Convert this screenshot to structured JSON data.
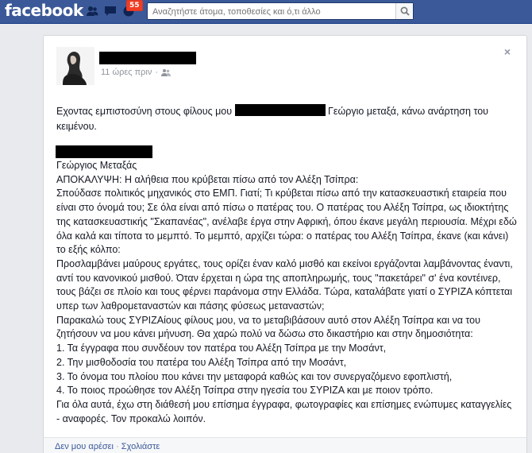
{
  "topbar": {
    "logo": "facebook",
    "badge_count": "55",
    "search_placeholder": "Αναζητήστε άτομα, τοποθεσίες και ό,τι άλλο",
    "icons": [
      "friends-icon",
      "messages-icon",
      "notifications-icon",
      "search-icon"
    ]
  },
  "post": {
    "time": "11 ώρες πριν",
    "intro_before": "Εχοντας εμπιστοσύνη στους φίλους μου ",
    "intro_after": " Γεώργιο μεταξά, κάνω ανάρτηση του κειμένου.",
    "lines": [
      "Γεώργιος Μεταξάς",
      "ΑΠΟΚΑΛΥΨΗ: Η αλήθεια που κρύβεται πίσω από τον Αλέξη Τσίπρα:",
      "Σπούδασε πολιτικός μηχανικός στο ΕΜΠ. Γιατί; Τι κρύβεται πίσω από την κατασκευαστική εταιρεία που είναι στο όνομά του; Σε όλα είναι από πίσω ο πατέρας του. Ο πατέρας του Αλέξη Τσίπρα, ως ιδιοκτήτης της κατασκευαστικής \"Σκαπανέας\", ανέλαβε έργα στην Αφρική, όπου έκανε μεγάλη περιουσία. Μέχρι εδώ όλα καλά και τίποτα το μεμπτό. Το μεμπτό, αρχίζει τώρα: ο πατέρας του Αλέξη Τσίπρα, έκανε (και κάνει) το εξής κόλπο:",
      "Προσλαμβάνει μαύρους εργάτες, τους ορίζει έναν καλό μισθό και εκείνοι εργάζονται λαμβάνοντας έναντι, αντί του κανονικού μισθού. Όταν έρχεται η ώρα της αποπληρωμής, τους \"πακετάρει\" σ' ένα κοντέινερ, τους βάζει σε πλοίο και τους φέρνει παράνομα στην Ελλάδα. Τώρα, καταλάβατε γιατί ο ΣΥΡΙΖΑ κόπτεται υπερ των λαθρομεταναστών και πάσης φύσεως μεταναστών;",
      "Παρακαλώ τους ΣΥΡΙΖΑίους φίλους μου, να το μεταβιβάσουν αυτό στον Αλέξη Τσίπρα και να του ζητήσουν να μου κάνει μήνυση. Θα χαρώ πολύ να δώσω στο δικαστήριο και στην δημοσιότητα:",
      "1. Τα έγγραφα που συνδέουν τον πατέρα του Αλέξη Τσίπρα με την Μοσάντ,",
      "2. Την μισθοδοσία του πατέρα του Αλέξη Τσίπρα από την Μοσάντ,",
      "3. Το όνομα του πλοίου που κάνει την μεταφορά καθώς και τον συνεργαζόμενο εφοπλιστή,",
      "4. Το ποιος προώθησε τον Αλέξη Τσίπρα στην ηγεσία του ΣΥΡΙΖΑ και με ποιον τρόπο.",
      "Για όλα αυτά, έχω στη διάθεσή μου επίσημα έγγραφα, φωτογραφίες και επίσημες ενώπυμες καταγγελίες - αναφορές. Τον προκαλώ λοιπόν."
    ],
    "close_label": "×",
    "actions": {
      "unlike": "Δεν μου αρέσει",
      "separator": "·",
      "comment": "Σχολιάστε"
    }
  },
  "colors": {
    "topbar": "#3b5998",
    "badge": "#f03d25",
    "link": "#3b5998"
  }
}
